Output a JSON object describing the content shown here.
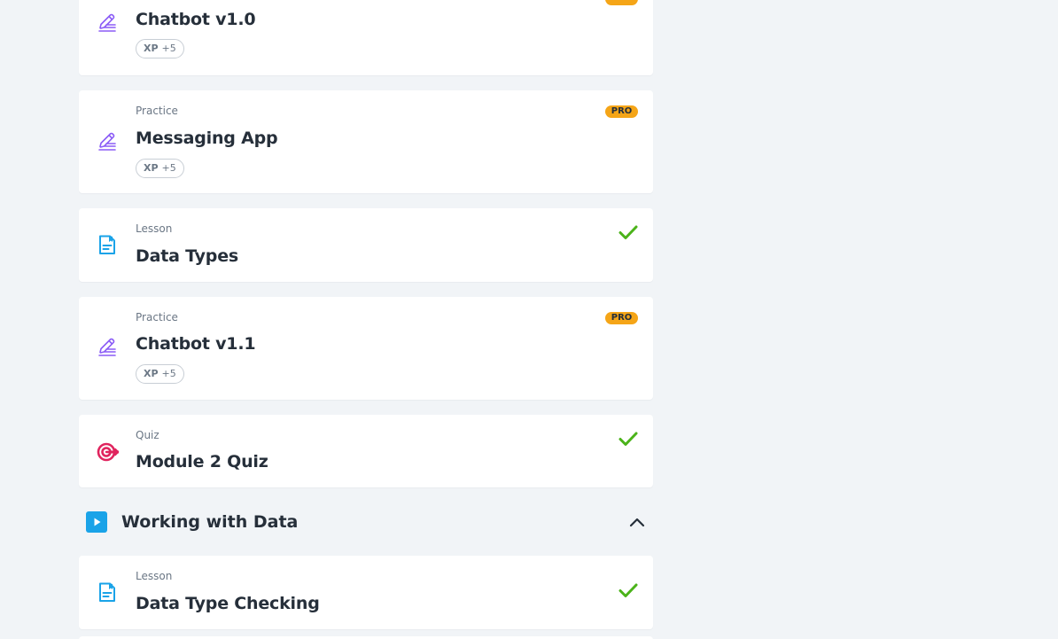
{
  "colors": {
    "background": "#f1f4f7",
    "card": "#ffffff",
    "practice_icon": "#8b5cf6",
    "lesson_icon": "#1aa3e8",
    "quiz_icon": "#e0245e",
    "check": "#4bb31a",
    "pro_badge": "#f5a517"
  },
  "items": [
    {
      "type": "",
      "title": "Chatbot v1.0",
      "xp_label": "XP",
      "xp_value": "+5",
      "icon": "pencil-icon",
      "status": "pro"
    },
    {
      "type": "Practice",
      "title": "Messaging App",
      "xp_label": "XP",
      "xp_value": "+5",
      "icon": "pencil-icon",
      "status": "pro",
      "badge": "PRO"
    },
    {
      "type": "Lesson",
      "title": "Data Types",
      "icon": "lesson-doc-icon",
      "status": "completed"
    },
    {
      "type": "Practice",
      "title": "Chatbot v1.1",
      "xp_label": "XP",
      "xp_value": "+5",
      "icon": "pencil-icon",
      "status": "pro",
      "badge": "PRO"
    },
    {
      "type": "Quiz",
      "title": "Module 2 Quiz",
      "icon": "target-icon",
      "status": "completed"
    }
  ],
  "module": {
    "title": "Working with Data",
    "icon": "play-icon",
    "toggle_icon": "chevron-up-icon"
  },
  "module_items": [
    {
      "type": "Lesson",
      "title": "Data Type Checking",
      "icon": "lesson-doc-icon",
      "status": "completed"
    }
  ]
}
